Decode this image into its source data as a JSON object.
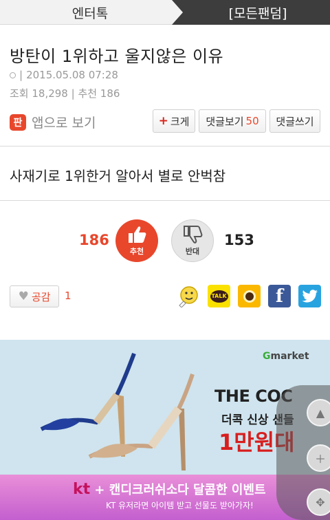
{
  "header": {
    "left_tab": "엔터톡",
    "right_tab": "[모든팬덤]"
  },
  "post": {
    "title": "방탄이 1위하고 울지않은 이유",
    "sep": "|",
    "date": "2015.05.08 07:28",
    "views_stats": "조회 18,298 | 추천 186",
    "app_view_label": "앱으로 보기",
    "app_logo_char": "판",
    "body": "사재기로 1위한거 알아서 별로 안벅참"
  },
  "toolbar": {
    "size_plus": "+",
    "size_label": "크게",
    "comments_label": "댓글보기",
    "comments_count": "50",
    "write_label": "댓글쓰기"
  },
  "votes": {
    "up_count": "186",
    "up_label": "추천",
    "down_count": "153",
    "down_label": "반대"
  },
  "empathy": {
    "label": "공감",
    "count": "1"
  },
  "share": {
    "icons": [
      "emoji-icon",
      "kakaotalk-icon",
      "kakaostory-icon",
      "facebook-icon",
      "twitter-icon"
    ],
    "talk_label": "TALK",
    "facebook_glyph": "f"
  },
  "ad": {
    "gmarket": "market",
    "gmarket_g": "G",
    "brand": "THE COC",
    "promo": "더콕 신상 샌들",
    "price": "1만원대",
    "banner_line1_kt": "kt",
    "banner_line1": " + 캔디크러쉬소다 달콤한 이벤트",
    "banner_line2": "KT 유저라면 아이템 받고 선물도 받아가자!"
  },
  "colors": {
    "accent": "#e8472c",
    "header_dark": "#3d3d3d",
    "facebook": "#3b5998",
    "twitter": "#29a3e0",
    "kakao": "#fae100"
  }
}
